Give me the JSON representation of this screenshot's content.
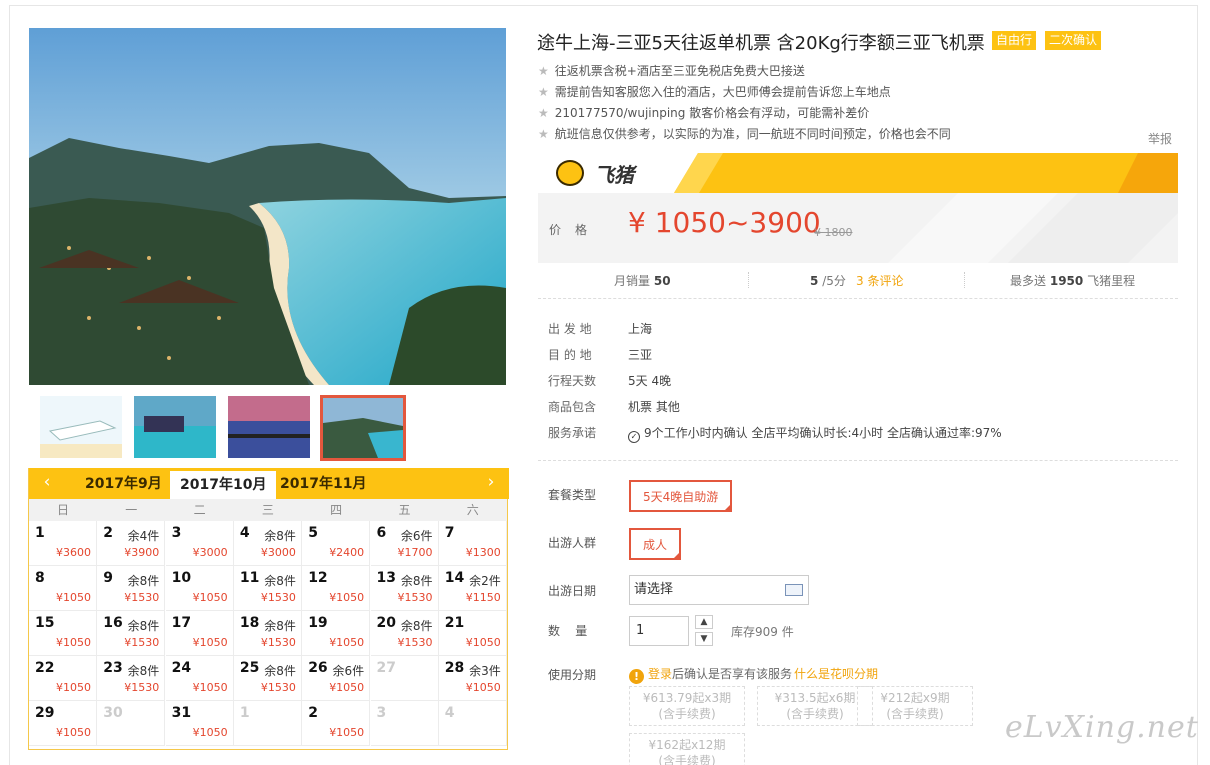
{
  "product": {
    "title": "途牛上海-三亚5天往返单机票 含20Kg行李额三亚飞机票",
    "tags": [
      "自由行",
      "二次确认"
    ],
    "features": [
      "往返机票含税+酒店至三亚免税店免费大巴接送",
      "需提前告知客服您入住的酒店，大巴师傅会提前告诉您上车地点",
      "210177570/wujinping 散客价格会有浮动，可能需补差价",
      "航班信息仅供参考，以实际的为准，同一航班不同时间预定，价格也会不同"
    ],
    "report_label": "举报"
  },
  "brand": {
    "name": "飞猪",
    "accent": "#fdc212"
  },
  "price": {
    "label": "价格",
    "range": "¥ 1050~3900",
    "original": "¥ 1800"
  },
  "stats": {
    "monthly_sales_label": "月销量",
    "monthly_sales": "50",
    "rating": "5",
    "rating_suffix": "/5分",
    "reviews": "3 条评论",
    "mileage_prefix": "最多送",
    "mileage": "1950",
    "mileage_suffix": "飞猪里程"
  },
  "details": [
    {
      "key": "出 发 地",
      "value": "上海"
    },
    {
      "key": "目 的 地",
      "value": "三亚"
    },
    {
      "key": "行程天数",
      "value": "5天 4晚"
    },
    {
      "key": "商品包含",
      "value": "机票  其他"
    },
    {
      "key": "服务承诺",
      "value": "9个工作小时内确认    全店平均确认时长:4小时    全店确认通过率:97%"
    }
  ],
  "options": {
    "package_label": "套餐类型",
    "package_value": "5天4晚自助游",
    "group_label": "出游人群",
    "group_value": "成人",
    "date_label": "出游日期",
    "date_placeholder": "请选择",
    "qty_label": "数    量",
    "qty_value": "1",
    "stock": "库存909 件",
    "installment_label": "使用分期",
    "installment_login": "登录",
    "installment_text": "后确认是否享有该服务",
    "installment_link": "什么是花呗分期",
    "installments": [
      {
        "line1": "¥613.79起x3期",
        "line2": "(含手续费)"
      },
      {
        "line1": "¥313.5起x6期",
        "line2": "(含手续费)"
      },
      {
        "line1": "¥212起x9期",
        "line2": "(含手续费)"
      },
      {
        "line1": "¥162起x12期",
        "line2": "(含手续费)"
      }
    ]
  },
  "calendar": {
    "prev": "‹",
    "next": "›",
    "months": [
      "2017年9月",
      "2017年10月",
      "2017年11月"
    ],
    "selected_month": 1,
    "weekdays": [
      "日",
      "一",
      "二",
      "三",
      "四",
      "五",
      "六"
    ],
    "days": [
      {
        "d": "1",
        "s": "",
        "p": "¥3600"
      },
      {
        "d": "2",
        "s": "余4件",
        "p": "¥3900"
      },
      {
        "d": "3",
        "s": "",
        "p": "¥3000"
      },
      {
        "d": "4",
        "s": "余8件",
        "p": "¥3000"
      },
      {
        "d": "5",
        "s": "",
        "p": "¥2400"
      },
      {
        "d": "6",
        "s": "余6件",
        "p": "¥1700"
      },
      {
        "d": "7",
        "s": "",
        "p": "¥1300"
      },
      {
        "d": "8",
        "s": "",
        "p": "¥1050"
      },
      {
        "d": "9",
        "s": "余8件",
        "p": "¥1530"
      },
      {
        "d": "10",
        "s": "",
        "p": "¥1050"
      },
      {
        "d": "11",
        "s": "余8件",
        "p": "¥1530"
      },
      {
        "d": "12",
        "s": "",
        "p": "¥1050"
      },
      {
        "d": "13",
        "s": "余8件",
        "p": "¥1530"
      },
      {
        "d": "14",
        "s": "余2件",
        "p": "¥1150"
      },
      {
        "d": "15",
        "s": "",
        "p": "¥1050"
      },
      {
        "d": "16",
        "s": "余8件",
        "p": "¥1530"
      },
      {
        "d": "17",
        "s": "",
        "p": "¥1050"
      },
      {
        "d": "18",
        "s": "余8件",
        "p": "¥1530"
      },
      {
        "d": "19",
        "s": "",
        "p": "¥1050"
      },
      {
        "d": "20",
        "s": "余8件",
        "p": "¥1530"
      },
      {
        "d": "21",
        "s": "",
        "p": "¥1050"
      },
      {
        "d": "22",
        "s": "",
        "p": "¥1050"
      },
      {
        "d": "23",
        "s": "余8件",
        "p": "¥1530"
      },
      {
        "d": "24",
        "s": "",
        "p": "¥1050"
      },
      {
        "d": "25",
        "s": "余8件",
        "p": "¥1530"
      },
      {
        "d": "26",
        "s": "余6件",
        "p": "¥1050"
      },
      {
        "d": "27",
        "s": "",
        "p": "",
        "dim": true
      },
      {
        "d": "28",
        "s": "余3件",
        "p": "¥1050"
      },
      {
        "d": "29",
        "s": "",
        "p": "¥1050"
      },
      {
        "d": "30",
        "s": "",
        "p": "",
        "dim": true
      },
      {
        "d": "31",
        "s": "",
        "p": "¥1050"
      },
      {
        "d": "1",
        "s": "",
        "p": "",
        "dim": true
      },
      {
        "d": "2",
        "s": "",
        "p": "¥1050"
      },
      {
        "d": "3",
        "s": "",
        "p": "",
        "dim": true
      },
      {
        "d": "4",
        "s": "",
        "p": "",
        "dim": true
      }
    ]
  },
  "watermark": "eLvXing.net"
}
